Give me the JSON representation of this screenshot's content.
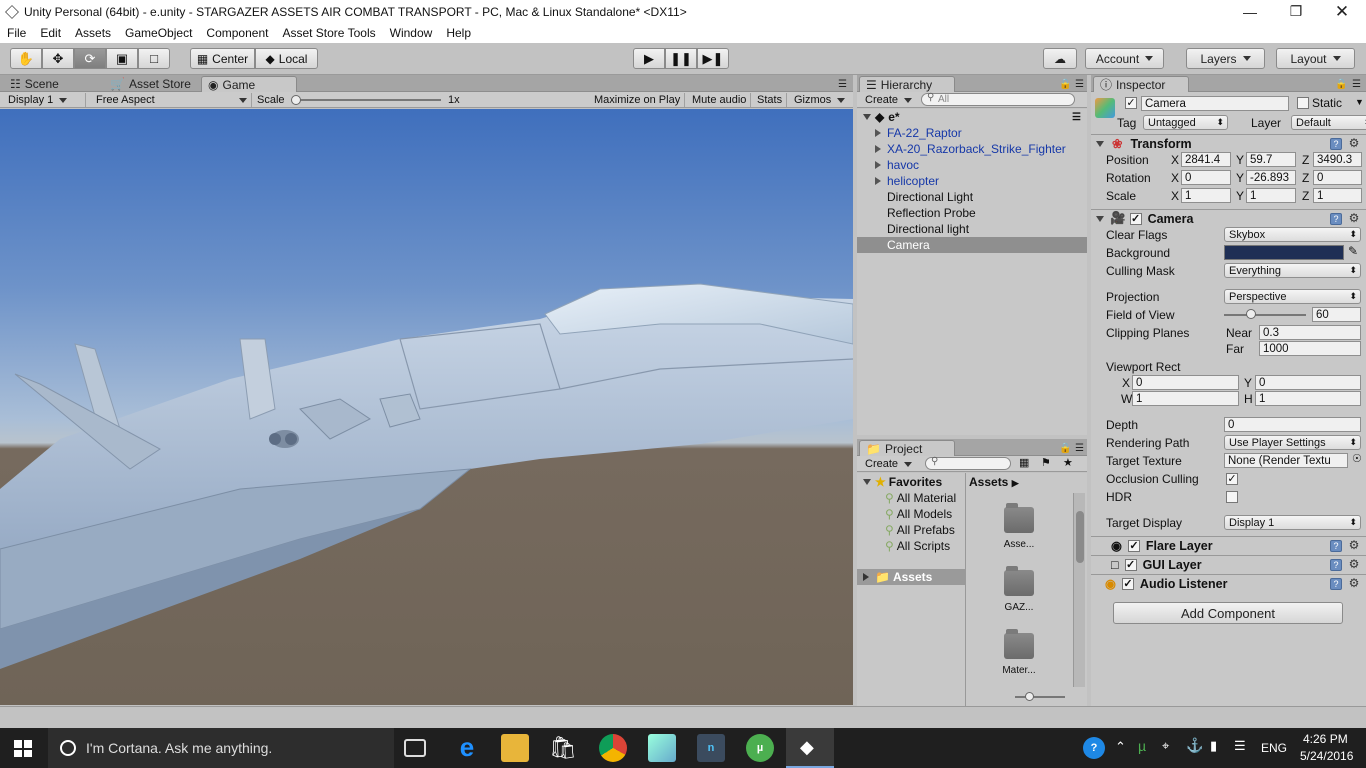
{
  "window": {
    "title": "Unity Personal (64bit) - e.unity - STARGAZER ASSETS  AIR COMBAT TRANSPORT - PC, Mac & Linux Standalone* <DX11>"
  },
  "menu": [
    "File",
    "Edit",
    "Assets",
    "GameObject",
    "Component",
    "Asset Store Tools",
    "Window",
    "Help"
  ],
  "toolbar": {
    "center": "Center",
    "local": "Local",
    "account": "Account",
    "layers": "Layers",
    "layout": "Layout"
  },
  "viewtabs": {
    "scene": "Scene",
    "asset_store": "Asset Store",
    "game": "Game"
  },
  "gamebar": {
    "display": "Display 1",
    "aspect": "Free Aspect",
    "scale_label": "Scale",
    "scale_value": "1x",
    "maximize": "Maximize on Play",
    "mute": "Mute audio",
    "stats": "Stats",
    "gizmos": "Gizmos"
  },
  "hierarchy": {
    "tab": "Hierarchy",
    "create": "Create",
    "search_placeholder": "All",
    "scene": "e*",
    "items": [
      {
        "label": "FA-22_Raptor",
        "prefab": true
      },
      {
        "label": "XA-20_Razorback_Strike_Fighter",
        "prefab": true
      },
      {
        "label": "havoc",
        "prefab": true
      },
      {
        "label": "helicopter",
        "prefab": true
      },
      {
        "label": "Directional Light",
        "prefab": false
      },
      {
        "label": "Reflection Probe",
        "prefab": false
      },
      {
        "label": "Directional light",
        "prefab": false
      },
      {
        "label": "Camera",
        "prefab": false,
        "selected": true
      }
    ]
  },
  "project": {
    "tab": "Project",
    "create": "Create",
    "favorites": "Favorites",
    "fav_items": [
      "All Material",
      "All Models",
      "All Prefabs",
      "All Scripts"
    ],
    "assets_root": "Assets",
    "breadcrumb": "Assets",
    "folders": [
      "Asse...",
      "GAZ...",
      "Mater..."
    ]
  },
  "inspector": {
    "tab": "Inspector",
    "object_name": "Camera",
    "static": "Static",
    "tag_label": "Tag",
    "tag": "Untagged",
    "layer_label": "Layer",
    "layer": "Default",
    "transform": {
      "title": "Transform",
      "position": {
        "label": "Position",
        "x": "2841.4",
        "y": "59.7",
        "z": "3490.3"
      },
      "rotation": {
        "label": "Rotation",
        "x": "0",
        "y": "-26.893",
        "z": "0"
      },
      "scale": {
        "label": "Scale",
        "x": "1",
        "y": "1",
        "z": "1"
      }
    },
    "camera": {
      "title": "Camera",
      "clear_flags_label": "Clear Flags",
      "clear_flags": "Skybox",
      "background_label": "Background",
      "background_color": "#1f2f55",
      "culling_mask_label": "Culling Mask",
      "culling_mask": "Everything",
      "projection_label": "Projection",
      "projection": "Perspective",
      "fov_label": "Field of View",
      "fov": "60",
      "fov_slider_fraction": 0.333,
      "clipping_label": "Clipping Planes",
      "near_label": "Near",
      "near": "0.3",
      "far_label": "Far",
      "far": "1000",
      "viewport_label": "Viewport Rect",
      "vx": "0",
      "vy": "0",
      "vw": "1",
      "vh": "1",
      "depth_label": "Depth",
      "depth": "0",
      "rendering_path_label": "Rendering Path",
      "rendering_path": "Use Player Settings",
      "target_texture_label": "Target Texture",
      "target_texture": "None (Render Textu",
      "occlusion_label": "Occlusion Culling",
      "occlusion": true,
      "hdr_label": "HDR",
      "hdr": false,
      "target_display_label": "Target Display",
      "target_display": "Display 1"
    },
    "flare_layer": "Flare Layer",
    "gui_layer": "GUI Layer",
    "audio_listener": "Audio Listener",
    "add_component": "Add Component"
  },
  "taskbar": {
    "cortana": "I'm Cortana. Ask me anything.",
    "lang": "ENG",
    "time": "4:26 PM",
    "date": "5/24/2016"
  }
}
